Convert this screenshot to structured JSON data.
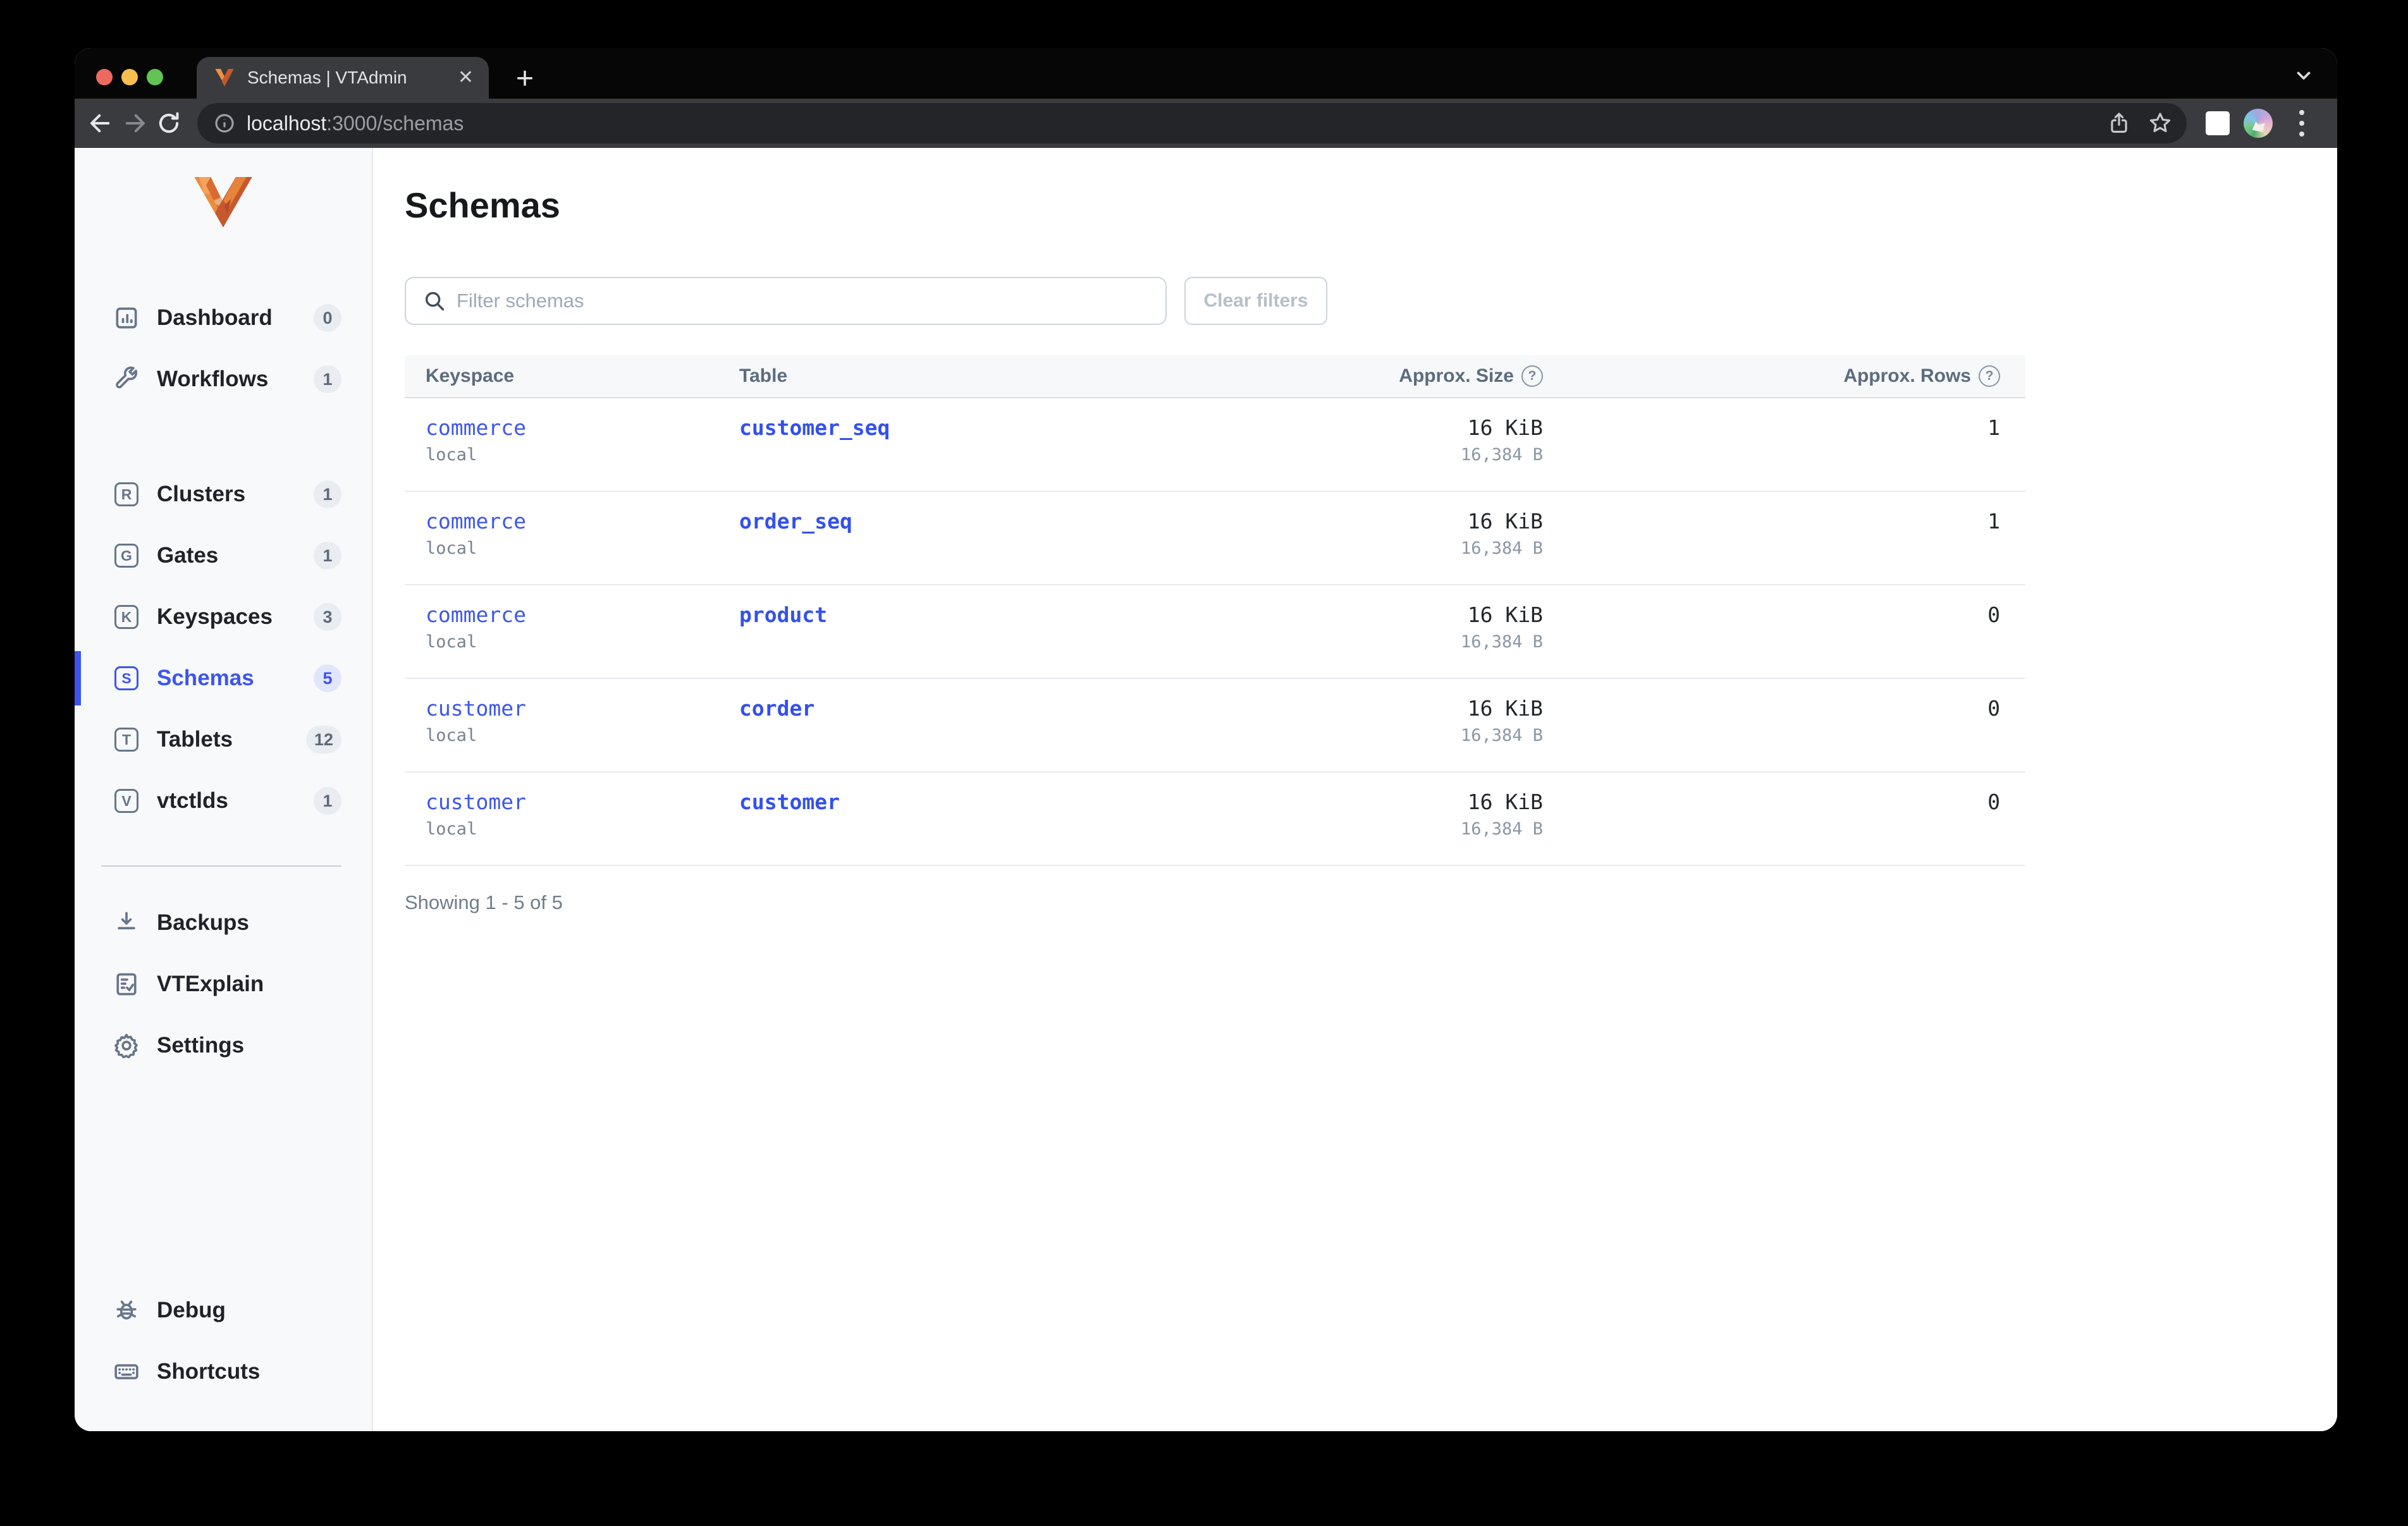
{
  "browser": {
    "tab_title": "Schemas | VTAdmin",
    "url_host": "localhost",
    "url_path": ":3000/schemas"
  },
  "sidebar": {
    "items": [
      {
        "label": "Dashboard",
        "count": "0",
        "icon": "dashboard-icon"
      },
      {
        "label": "Workflows",
        "count": "1",
        "icon": "wrench-icon"
      },
      {
        "label": "Clusters",
        "count": "1",
        "icon": "letter-r-icon"
      },
      {
        "label": "Gates",
        "count": "1",
        "icon": "letter-g-icon"
      },
      {
        "label": "Keyspaces",
        "count": "3",
        "icon": "letter-k-icon"
      },
      {
        "label": "Schemas",
        "count": "5",
        "icon": "letter-s-icon",
        "active": true
      },
      {
        "label": "Tablets",
        "count": "12",
        "icon": "letter-t-icon"
      },
      {
        "label": "vtctlds",
        "count": "1",
        "icon": "letter-v-icon"
      },
      {
        "label": "Backups",
        "icon": "download-icon"
      },
      {
        "label": "VTExplain",
        "icon": "doc-check-icon"
      },
      {
        "label": "Settings",
        "icon": "gear-icon"
      },
      {
        "label": "Debug",
        "icon": "bug-icon"
      },
      {
        "label": "Shortcuts",
        "icon": "keyboard-icon"
      }
    ],
    "letters": {
      "clusters": "R",
      "gates": "G",
      "keyspaces": "K",
      "schemas": "S",
      "tablets": "T",
      "vtctlds": "V"
    }
  },
  "page": {
    "title": "Schemas",
    "filter_placeholder": "Filter schemas",
    "clear_filters": "Clear filters",
    "showing": "Showing 1 - 5 of 5"
  },
  "table": {
    "columns": [
      "Keyspace",
      "Table",
      "Approx. Size",
      "Approx. Rows"
    ],
    "rows": [
      {
        "keyspace": "commerce",
        "cluster": "local",
        "table": "customer_seq",
        "size": "16 KiB",
        "bytes": "16,384 B",
        "approx_rows": "1"
      },
      {
        "keyspace": "commerce",
        "cluster": "local",
        "table": "order_seq",
        "size": "16 KiB",
        "bytes": "16,384 B",
        "approx_rows": "1"
      },
      {
        "keyspace": "commerce",
        "cluster": "local",
        "table": "product",
        "size": "16 KiB",
        "bytes": "16,384 B",
        "approx_rows": "0"
      },
      {
        "keyspace": "customer",
        "cluster": "local",
        "table": "corder",
        "size": "16 KiB",
        "bytes": "16,384 B",
        "approx_rows": "0"
      },
      {
        "keyspace": "customer",
        "cluster": "local",
        "table": "customer",
        "size": "16 KiB",
        "bytes": "16,384 B",
        "approx_rows": "0"
      }
    ]
  },
  "colors": {
    "accent": "#3d55ee",
    "link": "#3d56f0",
    "logo_orange": "#e8783a"
  }
}
